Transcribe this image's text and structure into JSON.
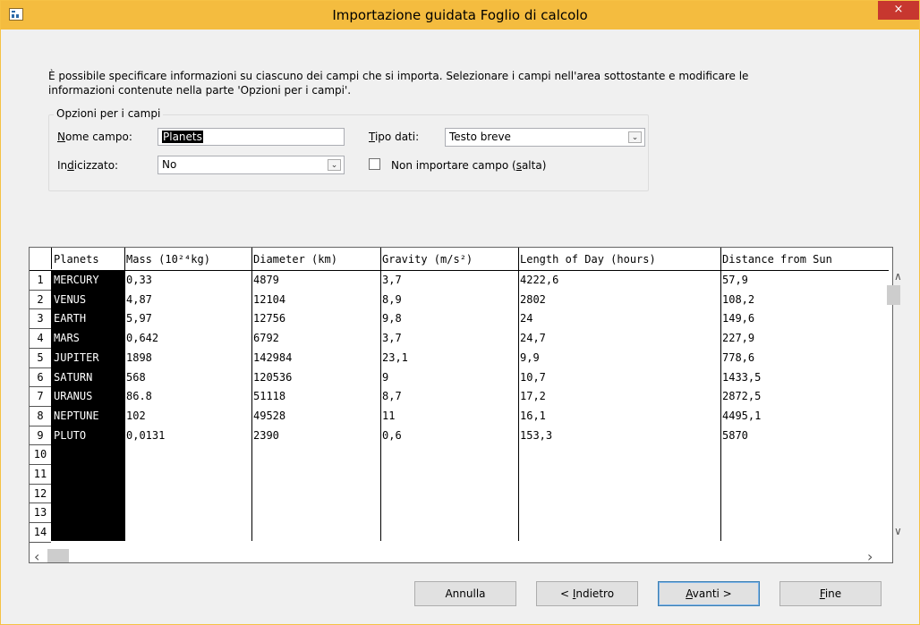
{
  "window": {
    "title": "Importazione guidata Foglio di calcolo",
    "close_label": "×"
  },
  "intro": {
    "line1": "È possibile specificare informazioni su ciascuno dei campi che si importa. Selezionare i campi nell'area sottostante e modificare le",
    "line2": "informazioni contenute nella parte 'Opzioni per i campi'."
  },
  "field_options": {
    "group_label": "Opzioni per i campi",
    "field_name": {
      "label_underlined": "N",
      "label_rest": "ome campo:",
      "value": "Planets"
    },
    "data_type": {
      "label_underlined": "T",
      "label_rest": "ipo dati:",
      "value": "Testo breve"
    },
    "indexed": {
      "label_pre": "In",
      "label_underlined": "d",
      "label_rest": "icizzato:",
      "value": "No"
    },
    "skip": {
      "label_pre": "Non importare campo (",
      "label_underlined": "s",
      "label_rest": "alta)",
      "checked": false
    }
  },
  "grid": {
    "columns": [
      "Planets",
      "Mass (10²⁴kg)",
      "Diameter (km)",
      "Gravity (m/s²)",
      "Length of Day (hours)",
      "Distance from Sun"
    ],
    "rows": [
      [
        "MERCURY",
        "0,33",
        "4879",
        "3,7",
        "4222,6",
        "57,9"
      ],
      [
        "VENUS",
        "4,87",
        "12104",
        "8,9",
        "2802",
        "108,2"
      ],
      [
        "EARTH",
        "5,97",
        "12756",
        "9,8",
        "24",
        "149,6"
      ],
      [
        "MARS",
        "0,642",
        "6792",
        "3,7",
        "24,7",
        "227,9"
      ],
      [
        "JUPITER",
        "1898",
        "142984",
        "23,1",
        "9,9",
        "778,6"
      ],
      [
        "SATURN",
        "568",
        "120536",
        "9",
        "10,7",
        "1433,5"
      ],
      [
        "URANUS",
        "86.8",
        "51118",
        "8,7",
        "17,2",
        "2872,5"
      ],
      [
        "NEPTUNE",
        "102",
        "49528",
        "11",
        "16,1",
        "4495,1"
      ],
      [
        "PLUTO",
        "0,0131",
        "2390",
        "0,6",
        "153,3",
        "5870"
      ]
    ],
    "row_numbers": [
      "1",
      "2",
      "3",
      "4",
      "5",
      "6",
      "7",
      "8",
      "9",
      "10",
      "11",
      "12",
      "13",
      "14"
    ]
  },
  "scroll": {
    "up": "∧",
    "down": "∨",
    "left": "‹",
    "right": "›"
  },
  "buttons": {
    "cancel": "Annulla",
    "back_pre": "< ",
    "back_underlined": "I",
    "back_rest": "ndietro",
    "next_underlined": "A",
    "next_rest": "vanti >",
    "finish_underlined": "F",
    "finish_rest": "ine"
  }
}
